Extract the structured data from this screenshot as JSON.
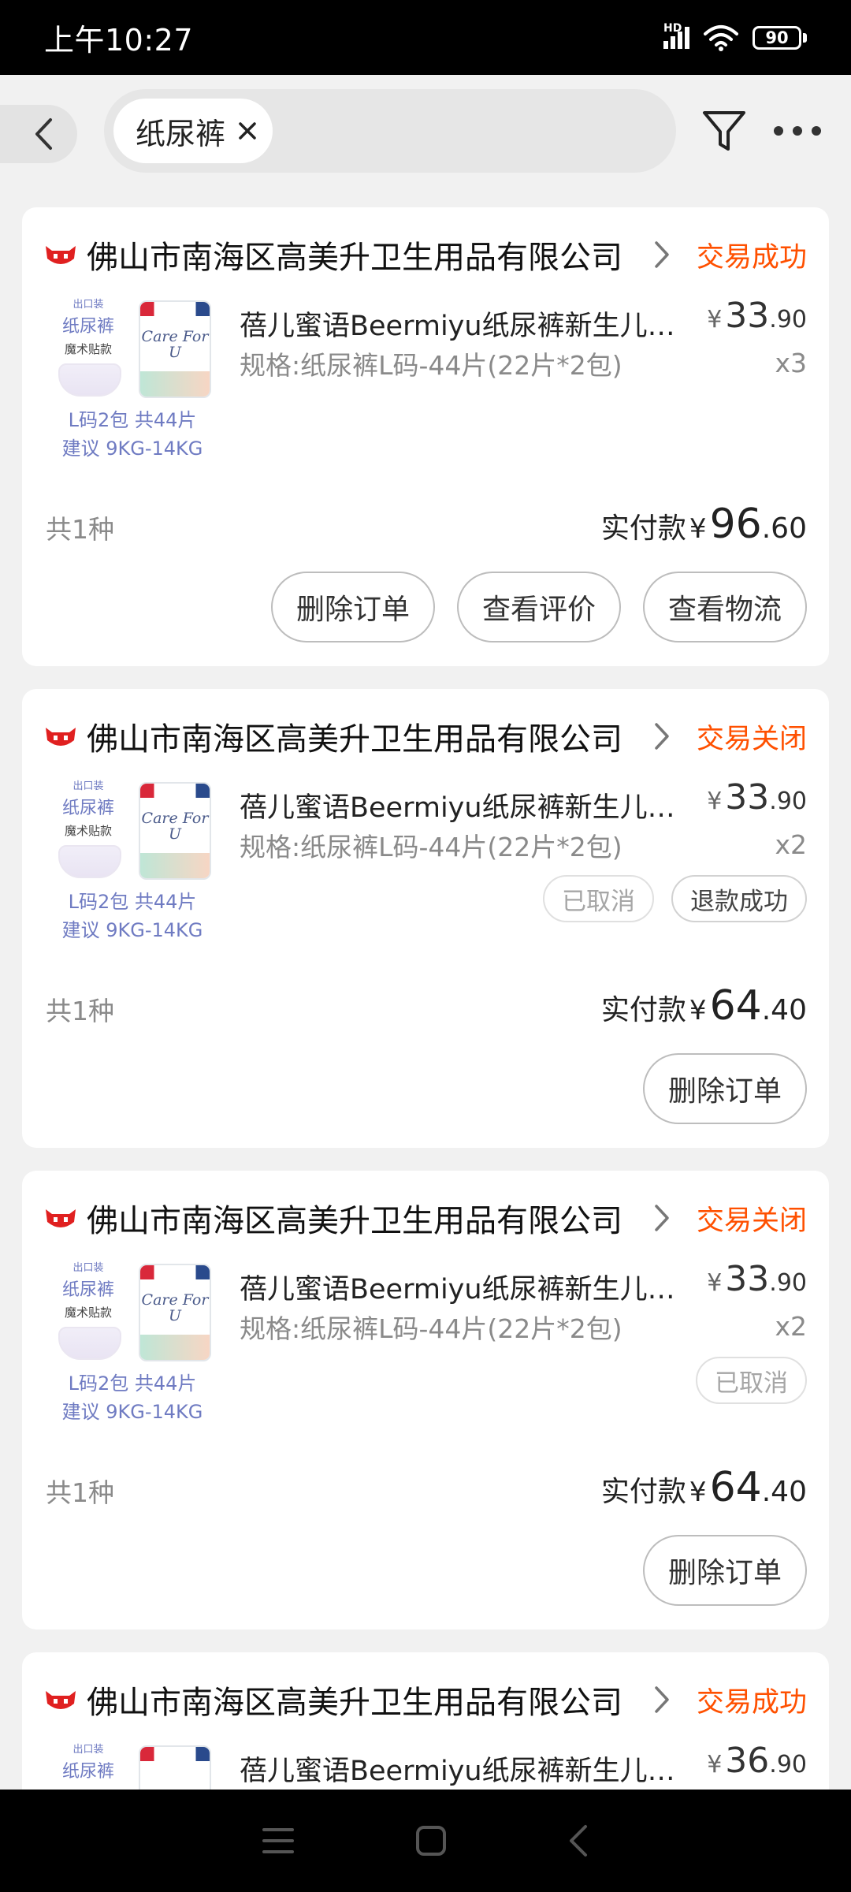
{
  "status_bar": {
    "time": "上午10:27",
    "network": "HD",
    "battery": "90"
  },
  "header": {
    "search_tag": "纸尿裤"
  },
  "orders": [
    {
      "store": "佛山市南海区高美升卫生用品有限公司",
      "status": "交易成功",
      "thumb_mini": "出口装",
      "thumb_main": "纸尿裤",
      "thumb_sub": "魔术贴款",
      "thumb_bag": "Care For U",
      "thumb_line1": "L码2包 共44片",
      "thumb_line2": "建议 9KG-14KG",
      "title": "蓓儿蜜语Beermiyu纸尿裤新生儿婴儿尿不湿",
      "spec": "规格:纸尿裤L码-44片(22片*2包)",
      "price_cur": "¥",
      "price_int": "33",
      "price_dec": ".90",
      "qty": "x3",
      "tags": [],
      "count": "共1种",
      "total_label": "实付款",
      "total_cur": "¥",
      "total_int": "96",
      "total_dec": ".60",
      "actions": [
        "删除订单",
        "查看评价",
        "查看物流"
      ]
    },
    {
      "store": "佛山市南海区高美升卫生用品有限公司",
      "status": "交易关闭",
      "thumb_mini": "出口装",
      "thumb_main": "纸尿裤",
      "thumb_sub": "魔术贴款",
      "thumb_bag": "Care For U",
      "thumb_line1": "L码2包 共44片",
      "thumb_line2": "建议 9KG-14KG",
      "title": "蓓儿蜜语Beermiyu纸尿裤新生儿婴儿尿不湿",
      "spec": "规格:纸尿裤L码-44片(22片*2包)",
      "price_cur": "¥",
      "price_int": "33",
      "price_dec": ".90",
      "qty": "x2",
      "tags": [
        "已取消",
        "退款成功"
      ],
      "count": "共1种",
      "total_label": "实付款",
      "total_cur": "¥",
      "total_int": "64",
      "total_dec": ".40",
      "actions": [
        "删除订单"
      ]
    },
    {
      "store": "佛山市南海区高美升卫生用品有限公司",
      "status": "交易关闭",
      "thumb_mini": "出口装",
      "thumb_main": "纸尿裤",
      "thumb_sub": "魔术贴款",
      "thumb_bag": "Care For U",
      "thumb_line1": "L码2包 共44片",
      "thumb_line2": "建议 9KG-14KG",
      "title": "蓓儿蜜语Beermiyu纸尿裤新生儿婴儿尿不湿",
      "spec": "规格:纸尿裤L码-44片(22片*2包)",
      "price_cur": "¥",
      "price_int": "33",
      "price_dec": ".90",
      "qty": "x2",
      "tags": [
        "已取消"
      ],
      "count": "共1种",
      "total_label": "实付款",
      "total_cur": "¥",
      "total_int": "64",
      "total_dec": ".40",
      "actions": [
        "删除订单"
      ]
    },
    {
      "store": "佛山市南海区高美升卫生用品有限公司",
      "status": "交易成功",
      "thumb_mini": "出口装",
      "thumb_main": "纸尿裤",
      "title": "蓓儿蜜语Beermiyu纸尿裤新生儿婴儿尿不湿",
      "price_cur": "¥",
      "price_int": "36",
      "price_dec": ".90"
    }
  ],
  "colors": {
    "accent": "#ff5000",
    "store_icon": "#e02020",
    "page_bg": "#f1f1f1"
  },
  "icons": {
    "back": "back-arrow-icon",
    "close": "close-icon",
    "filter": "filter-icon",
    "more": "more-dots-icon",
    "store": "tmall-cat-icon",
    "chevron": "chevron-right-icon",
    "nav_menu": "menu-icon",
    "nav_home": "home-square-icon",
    "nav_back": "nav-back-icon"
  }
}
